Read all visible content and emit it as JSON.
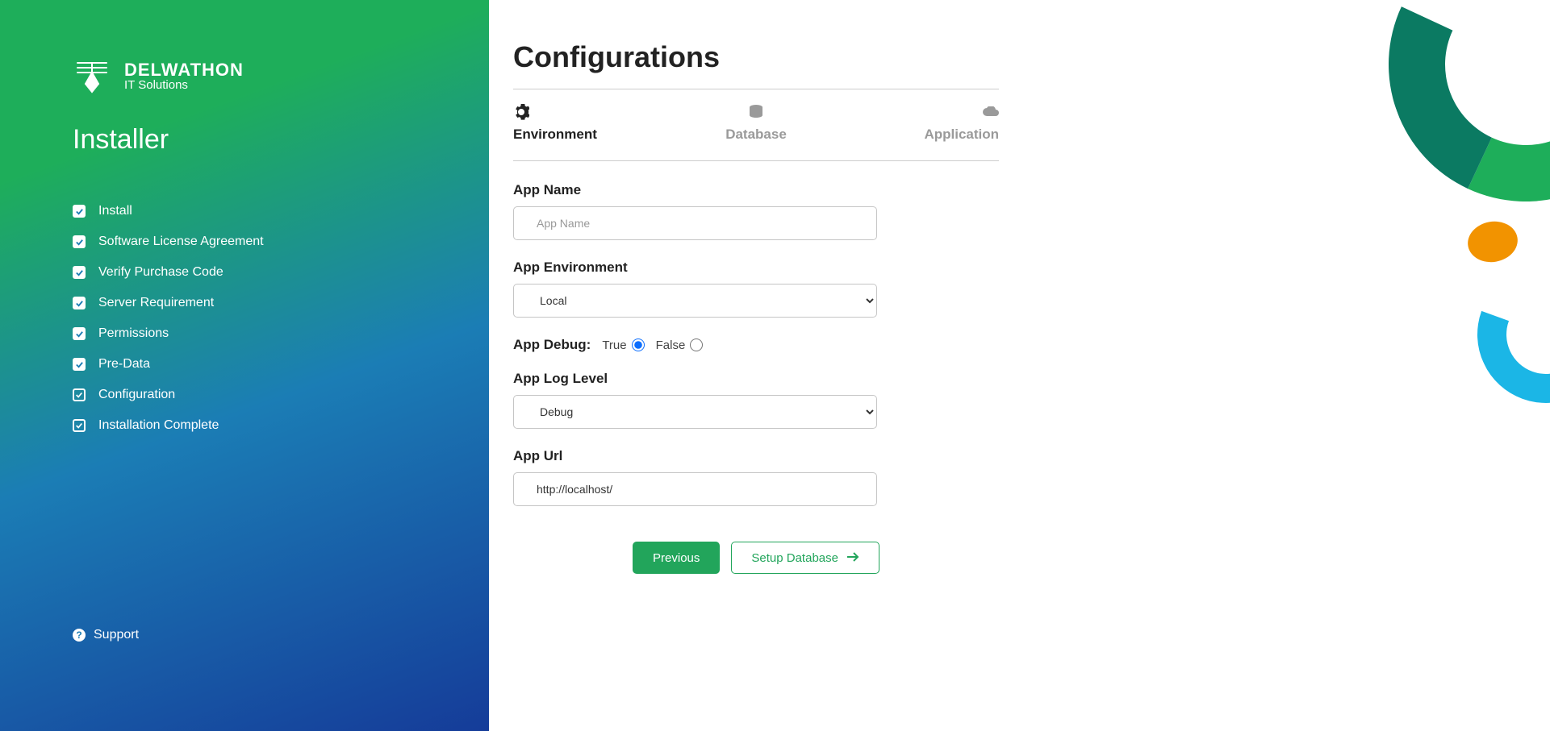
{
  "brand": {
    "name": "DELWATHON",
    "tagline": "IT Solutions"
  },
  "sidebar": {
    "title": "Installer",
    "steps": [
      {
        "label": "Install",
        "done": true
      },
      {
        "label": "Software License Agreement",
        "done": true
      },
      {
        "label": "Verify Purchase Code",
        "done": true
      },
      {
        "label": "Server Requirement",
        "done": true
      },
      {
        "label": "Permissions",
        "done": true
      },
      {
        "label": "Pre-Data",
        "done": true
      },
      {
        "label": "Configuration",
        "done": false
      },
      {
        "label": "Installation Complete",
        "done": false
      }
    ],
    "support": "Support"
  },
  "page": {
    "title": "Configurations"
  },
  "tabs": {
    "environment": "Environment",
    "database": "Database",
    "application": "Application"
  },
  "form": {
    "app_name": {
      "label": "App Name",
      "placeholder": "App Name",
      "value": ""
    },
    "app_env": {
      "label": "App Environment",
      "selected": "Local"
    },
    "app_debug": {
      "label": "App Debug:",
      "true_label": "True",
      "false_label": "False"
    },
    "app_log": {
      "label": "App Log Level",
      "selected": "Debug"
    },
    "app_url": {
      "label": "App Url",
      "value": "http://localhost/"
    }
  },
  "buttons": {
    "previous": "Previous",
    "next": "Setup Database"
  },
  "colors": {
    "accent": "#22a55b"
  }
}
